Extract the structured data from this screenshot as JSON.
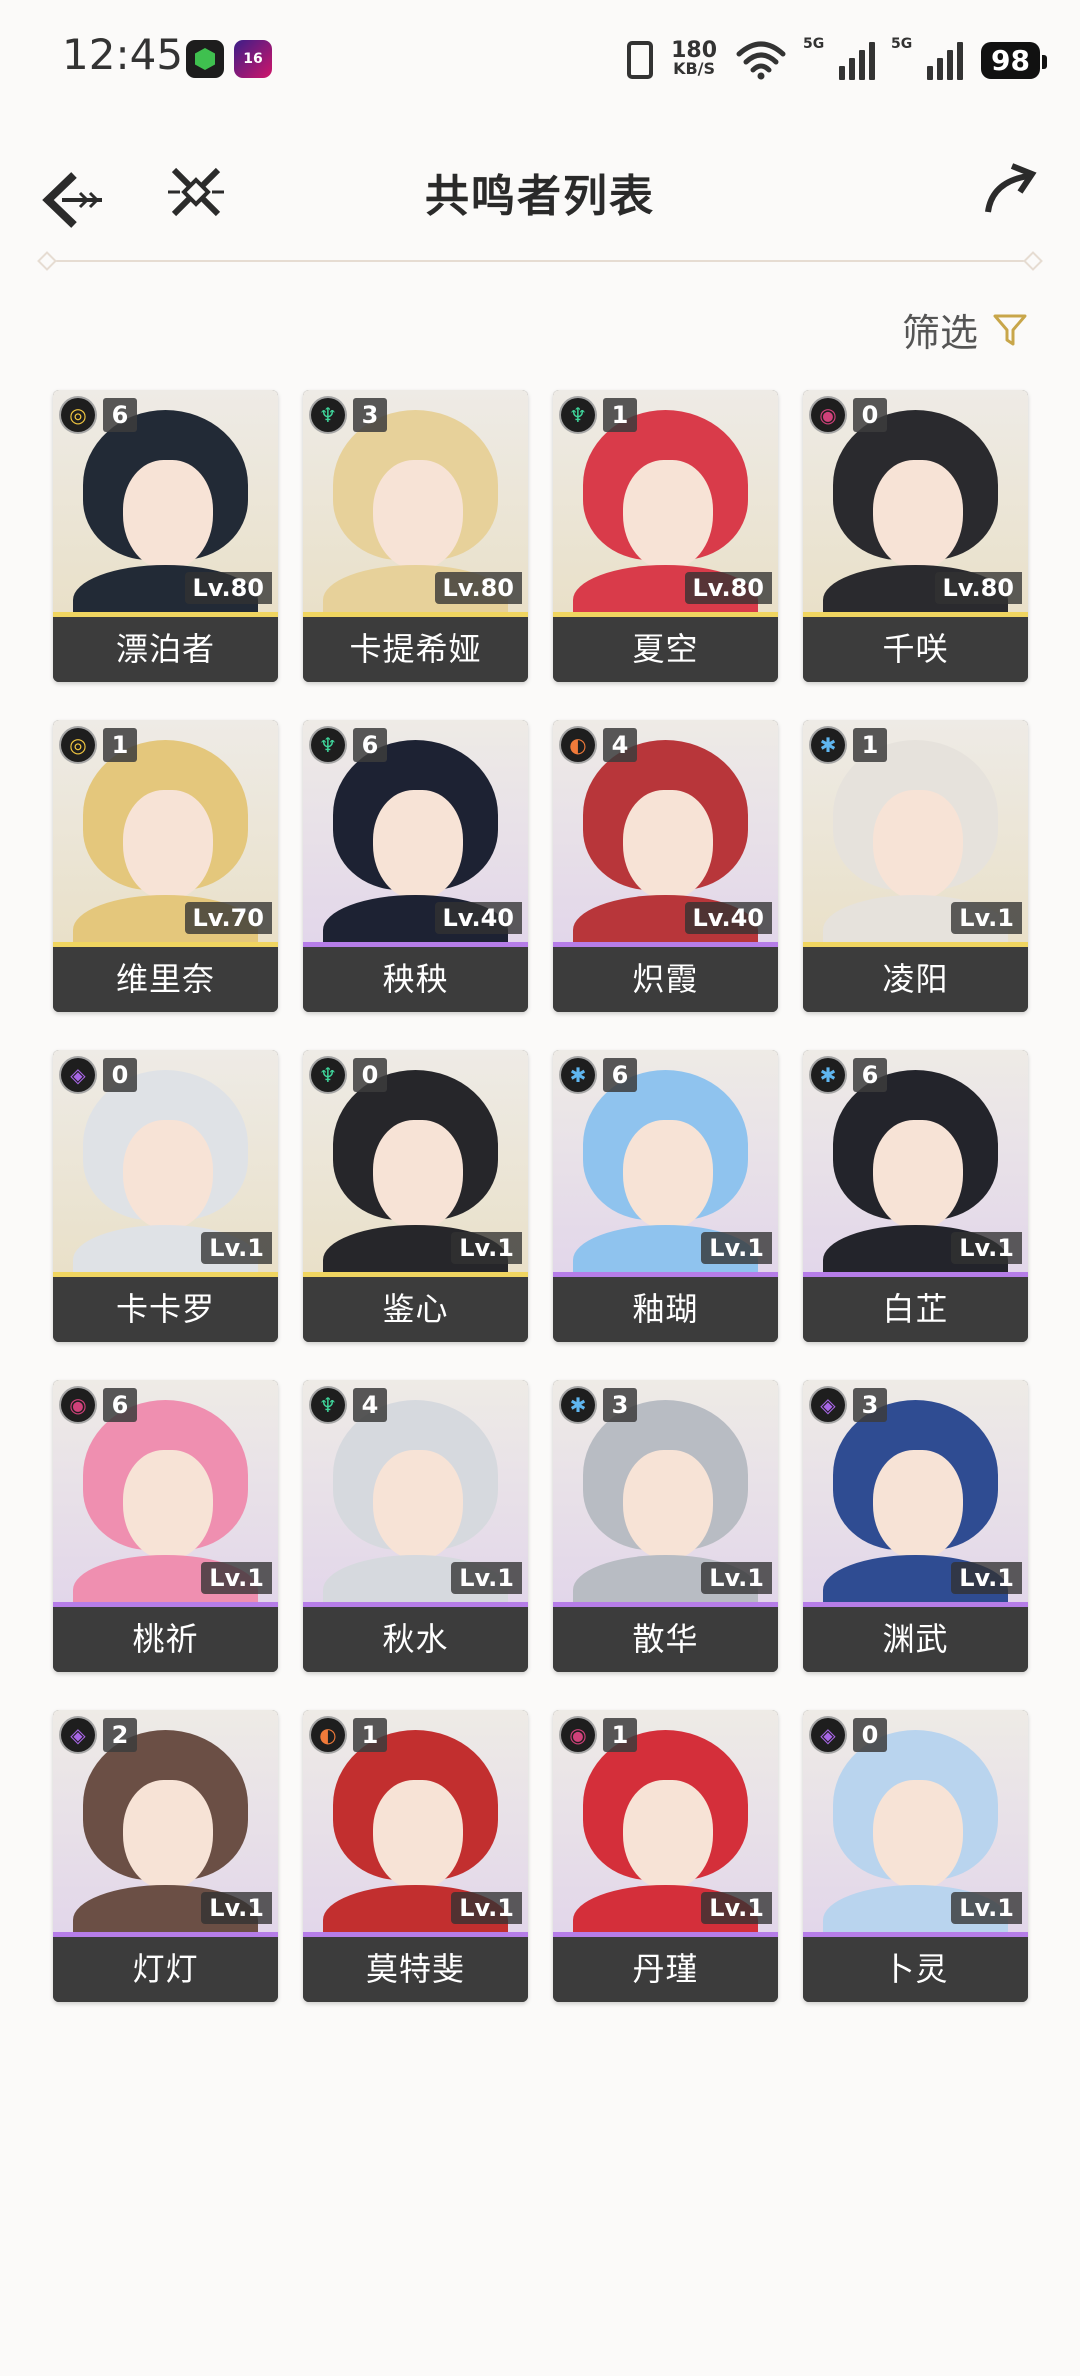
{
  "status_bar": {
    "time": "12:45",
    "app_badge_2": "16",
    "net_speed_value": "180",
    "net_speed_unit": "KB/S",
    "signal_1_tag": "5G",
    "signal_2_tag": "5G",
    "battery": "98"
  },
  "header": {
    "title": "共鸣者列表"
  },
  "filter": {
    "label": "筛选",
    "accent": "#c8a64a"
  },
  "colors": {
    "gold_rarity": "#f0d560",
    "purple_rarity": "#b67de8"
  },
  "characters": [
    {
      "name": "漂泊者",
      "chain": "6",
      "level": "Lv.80",
      "element": "spectro",
      "rarity": "gold",
      "hair": "#222a36"
    },
    {
      "name": "卡提希娅",
      "chain": "3",
      "level": "Lv.80",
      "element": "aero",
      "rarity": "gold",
      "hair": "#e7d19a"
    },
    {
      "name": "夏空",
      "chain": "1",
      "level": "Lv.80",
      "element": "aero",
      "rarity": "gold",
      "hair": "#d93b4a"
    },
    {
      "name": "千咲",
      "chain": "0",
      "level": "Lv.80",
      "element": "havoc",
      "rarity": "gold",
      "hair": "#2a2a2e"
    },
    {
      "name": "维里奈",
      "chain": "1",
      "level": "Lv.70",
      "element": "spectro",
      "rarity": "gold",
      "hair": "#e4c77c"
    },
    {
      "name": "秧秧",
      "chain": "6",
      "level": "Lv.40",
      "element": "aero",
      "rarity": "purple",
      "hair": "#1d2233"
    },
    {
      "name": "炽霞",
      "chain": "4",
      "level": "Lv.40",
      "element": "fusion",
      "rarity": "purple",
      "hair": "#b8363a"
    },
    {
      "name": "凌阳",
      "chain": "1",
      "level": "Lv.1",
      "element": "glacio",
      "rarity": "gold",
      "hair": "#e6e2dc"
    },
    {
      "name": "卡卡罗",
      "chain": "0",
      "level": "Lv.1",
      "element": "electro",
      "rarity": "gold",
      "hair": "#dfe2e6"
    },
    {
      "name": "鉴心",
      "chain": "0",
      "level": "Lv.1",
      "element": "aero",
      "rarity": "gold",
      "hair": "#26262a"
    },
    {
      "name": "釉瑚",
      "chain": "6",
      "level": "Lv.1",
      "element": "glacio",
      "rarity": "purple",
      "hair": "#8fc3ee"
    },
    {
      "name": "白芷",
      "chain": "6",
      "level": "Lv.1",
      "element": "glacio",
      "rarity": "purple",
      "hair": "#23242b"
    },
    {
      "name": "桃祈",
      "chain": "6",
      "level": "Lv.1",
      "element": "havoc",
      "rarity": "purple",
      "hair": "#ef8fb0"
    },
    {
      "name": "秋水",
      "chain": "4",
      "level": "Lv.1",
      "element": "aero",
      "rarity": "purple",
      "hair": "#d6d9de"
    },
    {
      "name": "散华",
      "chain": "3",
      "level": "Lv.1",
      "element": "glacio",
      "rarity": "purple",
      "hair": "#b8bcc3"
    },
    {
      "name": "渊武",
      "chain": "3",
      "level": "Lv.1",
      "element": "electro",
      "rarity": "purple",
      "hair": "#2f4c92"
    },
    {
      "name": "灯灯",
      "chain": "2",
      "level": "Lv.1",
      "element": "electro",
      "rarity": "purple",
      "hair": "#6b4f45"
    },
    {
      "name": "莫特斐",
      "chain": "1",
      "level": "Lv.1",
      "element": "fusion",
      "rarity": "purple",
      "hair": "#c22f2f"
    },
    {
      "name": "丹瑾",
      "chain": "1",
      "level": "Lv.1",
      "element": "havoc",
      "rarity": "purple",
      "hair": "#d42f3a"
    },
    {
      "name": "卜灵",
      "chain": "0",
      "level": "Lv.1",
      "element": "electro",
      "rarity": "purple",
      "hair": "#b9d4ee"
    }
  ]
}
